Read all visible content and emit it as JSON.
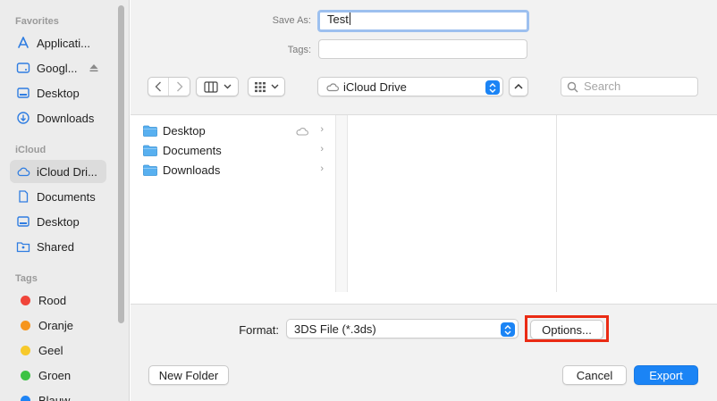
{
  "sidebar": {
    "favorites_heading": "Favorites",
    "favorites": [
      {
        "label": "Applicati...",
        "icon": "applications-icon"
      },
      {
        "label": "Googl...",
        "icon": "drive-icon",
        "eject": true
      },
      {
        "label": "Desktop",
        "icon": "desktop-icon"
      },
      {
        "label": "Downloads",
        "icon": "downloads-icon"
      }
    ],
    "icloud_heading": "iCloud",
    "icloud": [
      {
        "label": "iCloud Dri...",
        "icon": "icloud-icon",
        "selected": true
      },
      {
        "label": "Documents",
        "icon": "document-icon"
      },
      {
        "label": "Desktop",
        "icon": "desktop-icon"
      },
      {
        "label": "Shared",
        "icon": "shared-folder-icon"
      }
    ],
    "tags_heading": "Tags",
    "tags": [
      {
        "label": "Rood",
        "color": "#f0453a"
      },
      {
        "label": "Oranje",
        "color": "#f6951d"
      },
      {
        "label": "Geel",
        "color": "#f7c92b"
      },
      {
        "label": "Groen",
        "color": "#3cc243"
      },
      {
        "label": "Blauw",
        "color": "#1e84f5"
      }
    ]
  },
  "save_as": {
    "label": "Save As:",
    "value": "Test"
  },
  "tags_field": {
    "label": "Tags:",
    "value": ""
  },
  "toolbar": {
    "location": "iCloud Drive",
    "search_placeholder": "Search"
  },
  "browser": {
    "items": [
      {
        "name": "Desktop",
        "cloud": true
      },
      {
        "name": "Documents",
        "cloud": false
      },
      {
        "name": "Downloads",
        "cloud": false
      }
    ]
  },
  "format": {
    "label": "Format:",
    "value": "3DS File (*.3ds)",
    "options_label": "Options..."
  },
  "footer": {
    "new_folder": "New Folder",
    "cancel": "Cancel",
    "export": "Export"
  },
  "colors": {
    "accent": "#1b84f5",
    "highlight": "#ea2b14"
  }
}
